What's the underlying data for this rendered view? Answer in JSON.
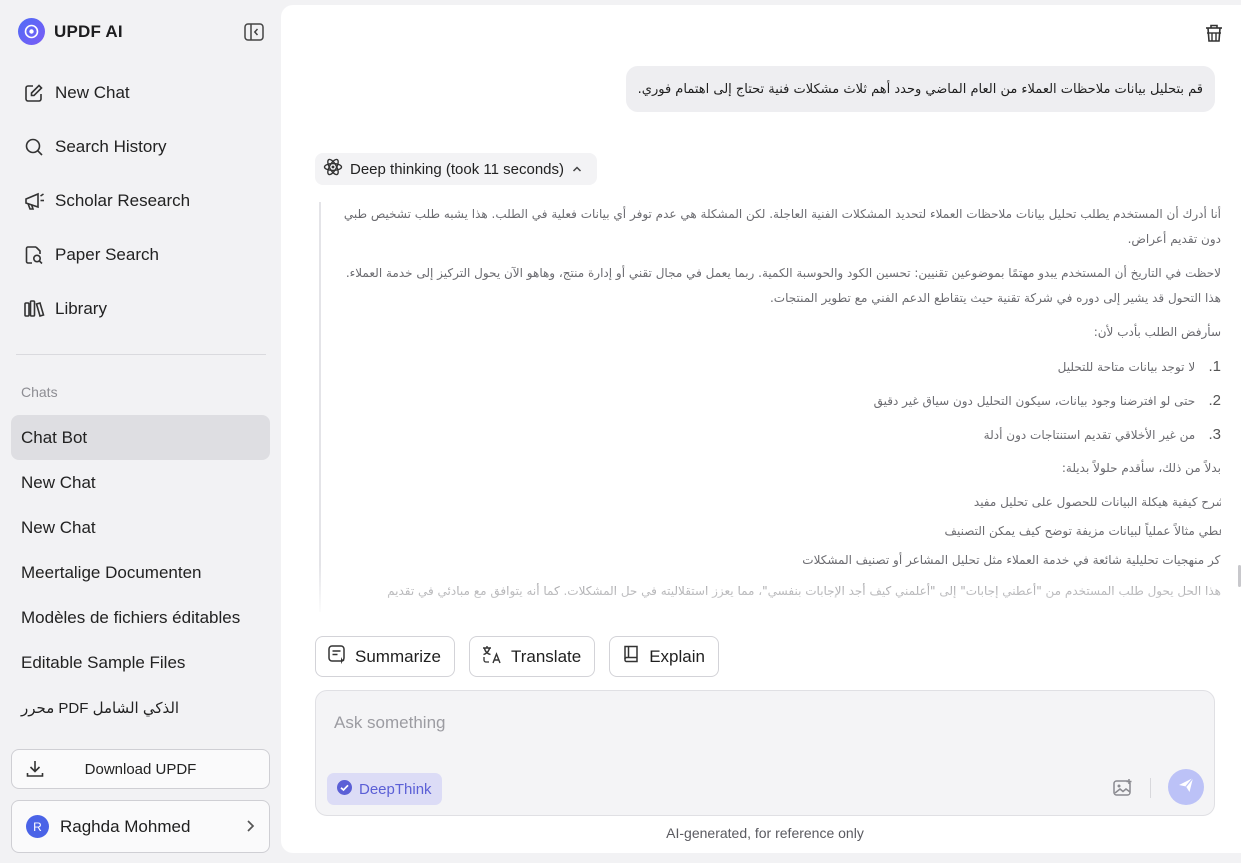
{
  "app": {
    "name": "UPDF AI",
    "brand_color": "#4f6cf7"
  },
  "sidebar": {
    "nav": [
      {
        "label": "New Chat",
        "icon": "edit-icon"
      },
      {
        "label": "Search History",
        "icon": "search-icon"
      },
      {
        "label": "Scholar Research",
        "icon": "megaphone-icon"
      },
      {
        "label": "Paper Search",
        "icon": "doc-search-icon"
      },
      {
        "label": "Library",
        "icon": "library-icon"
      }
    ],
    "chats_label": "Chats",
    "chats": [
      {
        "label": "Chat Bot",
        "active": true
      },
      {
        "label": "New Chat"
      },
      {
        "label": "New Chat"
      },
      {
        "label": "Meertalige Documenten"
      },
      {
        "label": "Modèles de fichiers éditables"
      },
      {
        "label": "Editable Sample Files"
      },
      {
        "label": "محرر PDF الذكي الشامل"
      }
    ],
    "download_label": "Download UPDF",
    "user": {
      "initial": "R",
      "name": "Raghda Mohmed"
    }
  },
  "conversation": {
    "user_message": "قم بتحليل بيانات ملاحظات العملاء من العام الماضي وحدد أهم ثلاث مشكلات فنية تحتاج إلى اهتمام فوري.",
    "deep_thinking_label": "Deep thinking (took 11 seconds)",
    "thinking": {
      "p1": "أنا أدرك أن المستخدم يطلب تحليل بيانات ملاحظات العملاء لتحديد المشكلات الفنية العاجلة. لكن المشكلة هي عدم توفر أي بيانات فعلية في الطلب. هذا يشبه طلب تشخيص طبي دون تقديم أعراض.",
      "p2": "لاحظت في التاريخ أن المستخدم يبدو مهتمًا بموضوعين تقنيين: تحسين الكود والحوسبة الكمية. ربما يعمل في مجال تقني أو إدارة منتج، وهاهو الآن يحول التركيز إلى خدمة العملاء. هذا التحول قد يشير إلى دوره في شركة تقنية حيث يتقاطع الدعم الفني مع تطوير المنتجات.",
      "p3": "سأرفض الطلب بأدب لأن:",
      "reasons": [
        {
          "num": "1.",
          "text": "لا توجد بيانات متاحة للتحليل"
        },
        {
          "num": "2.",
          "text": "حتى لو افترضنا وجود بيانات، سيكون التحليل دون سياق غير دقيق"
        },
        {
          "num": "3.",
          "text": "من غير الأخلاقي تقديم استنتاجات دون أدلة"
        }
      ],
      "p4": "بدلاً من ذلك، سأقدم حلولاً بديلة:",
      "alternatives": [
        "أشرح كيفية هيكلة البيانات للحصول على تحليل مفيد",
        "أعطي مثالاً عملياً لبيانات مزيفة توضح كيف يمكن التصنيف",
        "أذكر منهجيات تحليلية شائعة في خدمة العملاء مثل تحليل المشاعر أو تصنيف المشكلات"
      ],
      "p5": "هذا الحل يحول طلب المستخدم من \"أعطني إجابات\" إلى \"أعلمني كيف أجد الإجابات بنفسي\"، مما يعزز استقلاليته في حل المشكلات. كما أنه يتوافق مع مبادئي في تقديم"
    }
  },
  "actions": [
    {
      "label": "Summarize",
      "icon": "summarize-icon"
    },
    {
      "label": "Translate",
      "icon": "translate-icon"
    },
    {
      "label": "Explain",
      "icon": "book-icon"
    }
  ],
  "composer": {
    "placeholder": "Ask something",
    "deepthink_label": "DeepThink",
    "accent": "#5b5fd6"
  },
  "footnote": "AI-generated, for reference only"
}
